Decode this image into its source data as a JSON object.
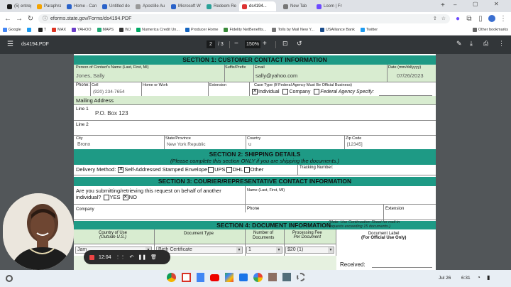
{
  "tabs": [
    {
      "label": "(5) entrepre",
      "color": "#1a1a1a"
    },
    {
      "label": "Paraphrase",
      "color": "#f4a300"
    },
    {
      "label": "Home - Canv",
      "color": "#2a62c9"
    },
    {
      "label": "Untitled doc",
      "color": "#2a62c9"
    },
    {
      "label": "Apostille Au",
      "color": "#999"
    },
    {
      "label": "Microsoft W",
      "color": "#2a62c9"
    },
    {
      "label": "Redeem Rew",
      "color": "#2aa198"
    },
    {
      "label": "ds4194...",
      "color": "#d33"
    },
    {
      "label": "New Tab",
      "color": "#777"
    },
    {
      "label": "Loom | Free",
      "color": "#6d4aff"
    }
  ],
  "address": {
    "url": "eforms.state.gov/Forms/ds4194.PDF"
  },
  "bookmarks": [
    "Google",
    "",
    "T",
    "MAX",
    "YAHOO",
    "MAPS",
    "WJ",
    "Numerica Credit Un...",
    "Producer Home",
    "Fidelity NetBenefits...",
    "Tolls by Mail New Y...",
    "USAlliance Bank",
    "Twitter"
  ],
  "other_bookmarks": "Other bookmarks",
  "pdf": {
    "filename": "ds4194.PDF",
    "page_current": "2",
    "page_total": "/ 3",
    "zoom": "150%"
  },
  "form": {
    "sec1": "SECTION 1: CUSTOMER CONTACT INFORMATION",
    "l_name": "Person of Contact's Name (Last, First, MI)",
    "v_name": "Jones, Sally",
    "l_suffix": "Suffix/Prefix",
    "l_email": "Email",
    "v_email": "sally@yahoo.com",
    "l_date": "Date (mm/dd/yyyy)",
    "v_date": "07/26/2023",
    "l_phone": "Phone:",
    "l_cell": "Cell",
    "v_cell": "(920) 234-7654",
    "l_homework": "Home or Work",
    "l_ext": "Extension",
    "l_casetype": "Case Type (If Federal Agency Must Be Official Business)",
    "opt_individual": "Individual",
    "opt_company": "Company",
    "opt_federal": "Federal Agency Specify:",
    "l_mailing": "Mailing Address",
    "l_line1": "Line 1",
    "v_line1": "P.O. Box 123",
    "l_line2": "Line 2",
    "l_city": "City",
    "v_city": "Bronx",
    "l_state": "State/Province",
    "v_state": "New York Republic",
    "l_country": "Country",
    "v_country": "u",
    "l_zip": "Zip Code",
    "v_zip": "[12345]",
    "sec2": "SECTION 2: SHIPPING DETAILS",
    "sec2_sub": "(Please complete this section ONLY if you are shipping the documents.)",
    "l_delivery": "Delivery Method:",
    "opt_sase": "Self-Addressed Stamped Envelope",
    "opt_ups": "UPS",
    "opt_dhl": "DHL",
    "opt_other": "Other",
    "l_tracking": "Tracking Number:",
    "sec3": "SECTION 3: COURIER/REPRESENTATIVE CONTACT INFORMATION",
    "q_behalf": "Are you submitting/retrieving this request on behalf of another individual?",
    "opt_yes": "YES",
    "opt_no": "NO",
    "l_rep_name": "Name (Last, First, MI)",
    "l_company": "Company",
    "l_rep_phone": "Phone",
    "l_rep_ext": "Extension",
    "sec4": "SECTION 4: DOCUMENT INFORMATION",
    "sec4_note": "(Note: Use Continuation Sheet for mail-in requests exceeding 15 documents.)",
    "col_country": "Country of Use",
    "col_country_sub": "(Outside U.S.)",
    "col_doctype": "Document Type",
    "col_numdocs": "Number of Documents",
    "col_fee": "Processing Fee",
    "col_fee_sub": "Per Document",
    "col_label": "Document Label",
    "col_label_sub": "(For Official Use Only)",
    "row_country": "Jam",
    "row_doctype": "Birth Certificate",
    "row_num": "1",
    "row_fee": "$20 (1)",
    "l_received": "Received:"
  },
  "recorder": {
    "time": "12:04"
  },
  "taskbar": {
    "date": "Jul 26",
    "time": "6:31"
  },
  "colors": {
    "section": "#1e9a85",
    "highlight": "#d8ecd0",
    "toolbar": "#323639"
  }
}
